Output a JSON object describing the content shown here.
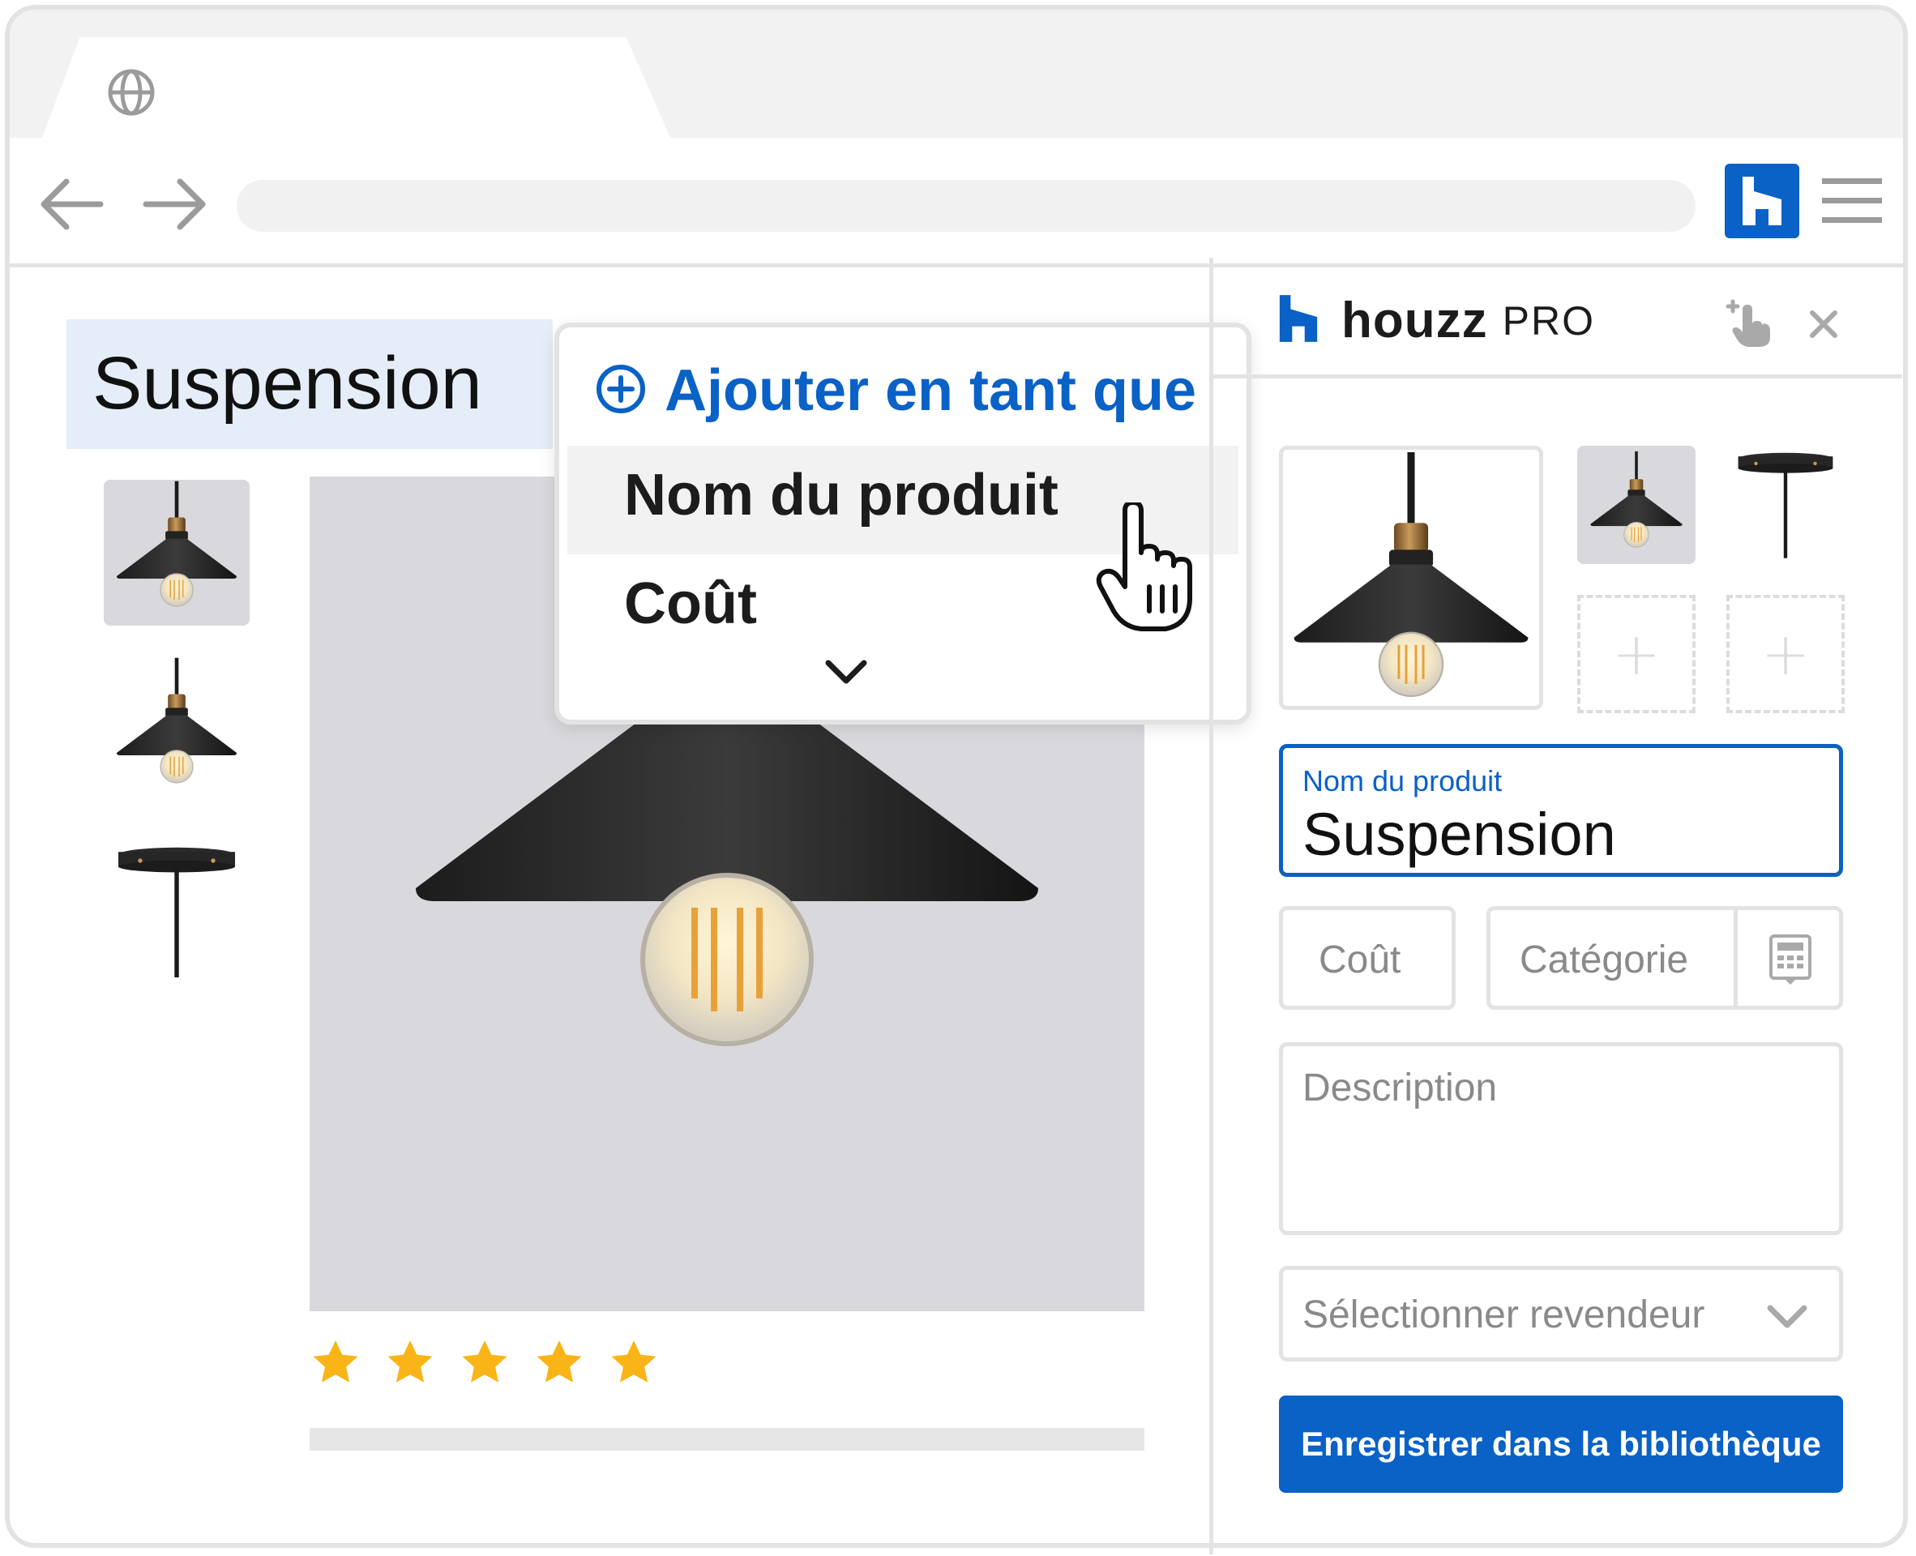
{
  "colors": {
    "accent": "#0a61c6",
    "selection": "#e5eef8",
    "star": "#f9b417",
    "border": "#e3e3e3"
  },
  "browser": {
    "tab_icon": "globe-icon",
    "nav_icons": [
      "arrow-left-icon",
      "arrow-right-icon"
    ],
    "extension_icon": "houzz-logo-icon",
    "menu_icon": "hamburger-menu-icon"
  },
  "page": {
    "selected_text": "Suspension",
    "rating_stars": 5
  },
  "popup": {
    "header_icon": "plus-circle-icon",
    "header_label": "Ajouter en tant que",
    "items": [
      {
        "label": "Nom du produit",
        "highlighted": true
      },
      {
        "label": "Coût",
        "highlighted": false
      }
    ],
    "more_icon": "chevron-down-icon"
  },
  "panel": {
    "brand_name": "houzz",
    "brand_suffix": "PRO",
    "header_icons": [
      "tap-hand-icon",
      "close-icon"
    ],
    "name_field": {
      "label": "Nom du produit",
      "value": "Suspension"
    },
    "cost_placeholder": "Coût",
    "category_placeholder": "Catégorie",
    "description_placeholder": "Description",
    "vendor_placeholder": "Sélectionner revendeur",
    "save_label": "Enregistrer dans la bibliothèque"
  }
}
